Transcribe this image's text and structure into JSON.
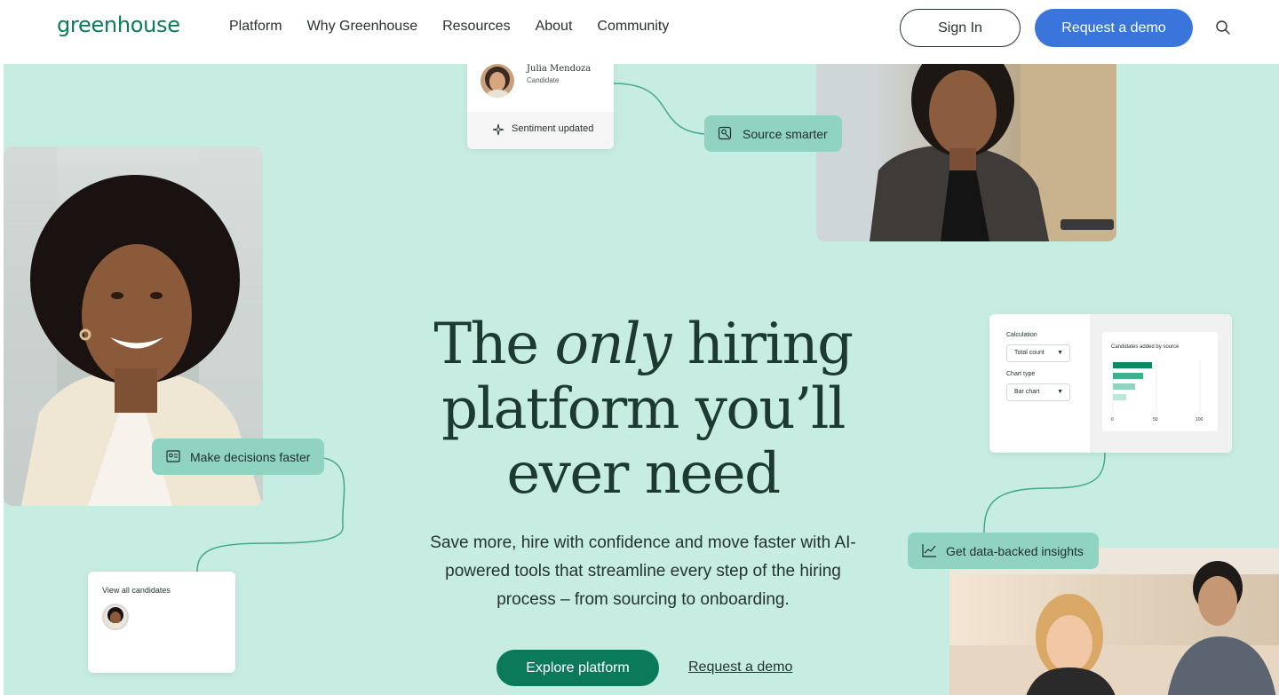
{
  "nav": {
    "logo": "greenhouse",
    "links": [
      "Platform",
      "Why Greenhouse",
      "Resources",
      "About",
      "Community"
    ],
    "sign_in": "Sign In",
    "request_demo": "Request a demo",
    "search_icon": "search-icon"
  },
  "hero": {
    "headline_pre": "The ",
    "headline_em": "only",
    "headline_post": " hiring platform you’ll ever need",
    "subtext": "Save more, hire with confidence and move faster with AI-powered tools that streamline every step of the hiring process – from sourcing to onboarding.",
    "cta_primary": "Explore platform",
    "cta_secondary": "Request a demo"
  },
  "profile_card": {
    "name": "Julia Mendoza",
    "role": "Candidate",
    "status": "Sentiment updated",
    "status_icon": "sparkle-icon"
  },
  "pills": {
    "source": "Source smarter",
    "source_icon": "person-search-icon",
    "decisions": "Make decisions faster",
    "decisions_icon": "compare-icon",
    "insights": "Get data-backed insights",
    "insights_icon": "line-chart-icon"
  },
  "chart_widget": {
    "calc_label": "Calculation",
    "calc_value": "Total count",
    "type_label": "Chart type",
    "type_value": "Bar chart",
    "chart_title": "Candidates added by source",
    "ticks": [
      "0",
      "50",
      "100"
    ]
  },
  "candidates_card": {
    "label": "View all candidates"
  },
  "colors": {
    "hero_bg": "#c7ede2",
    "brand_green": "#0b7a5b",
    "demo_blue": "#3a75db",
    "pill_bg": "#8fd3c0"
  }
}
